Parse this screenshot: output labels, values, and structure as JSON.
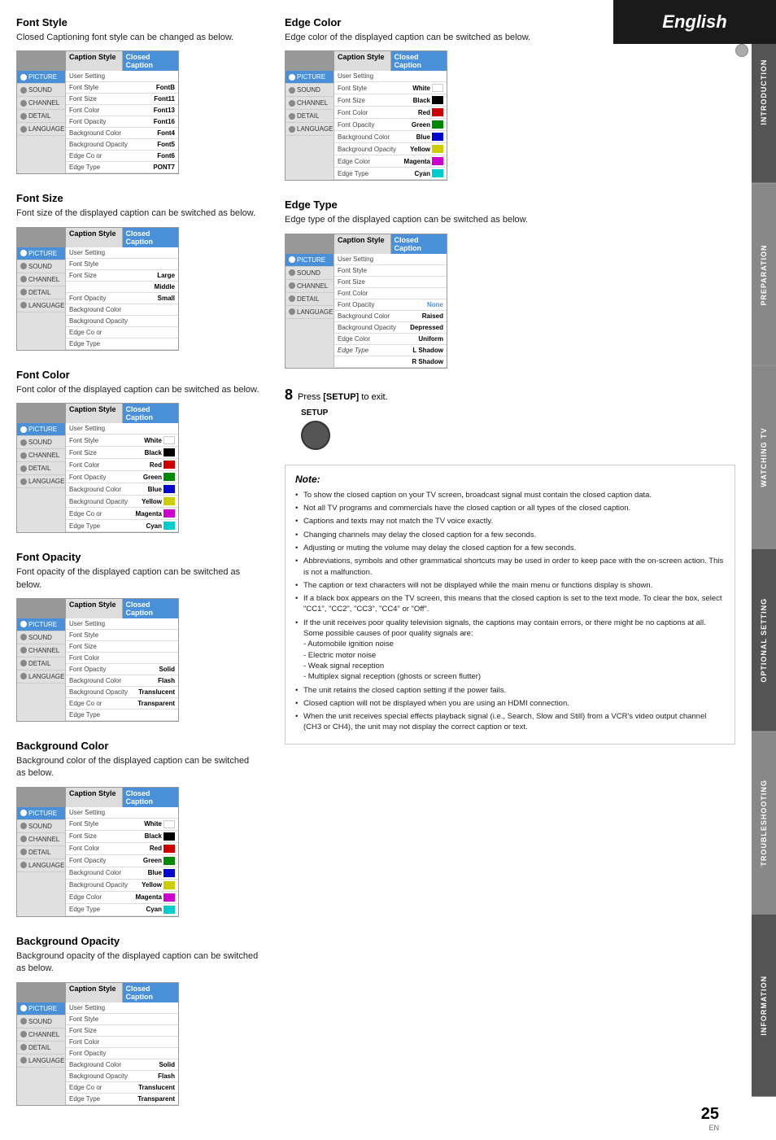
{
  "header": {
    "title": "English"
  },
  "sidebar_tabs": [
    {
      "label": "INTRODUCTION",
      "style": "dark"
    },
    {
      "label": "PREPARATION",
      "style": "accent"
    },
    {
      "label": "WATCHING TV",
      "style": "accent"
    },
    {
      "label": "OPTIONAL SETTING",
      "style": "active"
    },
    {
      "label": "TROUBLESHOOTING",
      "style": "accent"
    },
    {
      "label": "INFORMATION",
      "style": "dark"
    }
  ],
  "sections": {
    "font_style": {
      "title": "Font Style",
      "desc": "Closed Captioning font style can be changed as below.",
      "menu": {
        "col2": "Caption Style",
        "col3": "Closed Caption",
        "sidebar_items": [
          "PICTURE",
          "SOUND",
          "CHANNEL",
          "DETAIL",
          "LANGUAGE"
        ],
        "rows": [
          {
            "label": "User Setting",
            "value": ""
          },
          {
            "label": "Font Style",
            "value": "Font8"
          },
          {
            "label": "Font Size",
            "value": "Font11"
          },
          {
            "label": "Font Color",
            "value": "Font13"
          },
          {
            "label": "Font Opacity",
            "value": "Font16"
          },
          {
            "label": "Background Color",
            "value": "Font4"
          },
          {
            "label": "Background Opacity",
            "value": "Font5"
          },
          {
            "label": "Edge Co or",
            "value": "Font6"
          },
          {
            "label": "Edge Type",
            "value": "PONT7"
          }
        ]
      }
    },
    "font_size": {
      "title": "Font Size",
      "desc": "Font size of the displayed caption can be switched as below.",
      "menu": {
        "col2": "Caption Style",
        "col3": "Closed Caption",
        "sidebar_items": [
          "PICTURE",
          "SOUND",
          "CHANNEL",
          "DETAIL",
          "LANGUAGE"
        ],
        "rows": [
          {
            "label": "User Setting",
            "value": ""
          },
          {
            "label": "Font Style",
            "value": ""
          },
          {
            "label": "Font Size",
            "value": "Large"
          },
          {
            "label": "",
            "value": "Middle"
          },
          {
            "label": "Font Opacity",
            "value": "Small"
          },
          {
            "label": "Background Color",
            "value": ""
          },
          {
            "label": "Background Opacity",
            "value": ""
          },
          {
            "label": "Edge Co or",
            "value": ""
          },
          {
            "label": "Edge Type",
            "value": ""
          }
        ]
      }
    },
    "font_color": {
      "title": "Font Color",
      "desc": "Font color of the displayed caption can be switched as below.",
      "menu": {
        "col2": "Caption Style",
        "col3": "Closed Caption",
        "sidebar_items": [
          "PICTURE",
          "SOUND",
          "CHANNEL",
          "DETAIL",
          "LANGUAGE"
        ],
        "rows": [
          {
            "label": "User Setting",
            "value": ""
          },
          {
            "label": "Font Style",
            "value": "White",
            "swatch": "#fff"
          },
          {
            "label": "Font Size",
            "value": "Black",
            "swatch": "#000"
          },
          {
            "label": "Font Color",
            "value": "Red",
            "swatch": "#c00"
          },
          {
            "label": "Font Opacity",
            "value": "Green",
            "swatch": "#080"
          },
          {
            "label": "Background Color",
            "value": "Blue",
            "swatch": "#00c"
          },
          {
            "label": "Background Opacity",
            "value": "Yellow",
            "swatch": "#cc0"
          },
          {
            "label": "Edge Co or",
            "value": "Magenta",
            "swatch": "#c0c"
          },
          {
            "label": "Edge Type",
            "value": "Cyan",
            "swatch": "#0cc"
          }
        ]
      }
    },
    "font_opacity": {
      "title": "Font Opacity",
      "desc": "Font opacity of the displayed caption can be switched as below.",
      "menu": {
        "col2": "Caption Style",
        "col3": "Closed Caption",
        "sidebar_items": [
          "PICTURE",
          "SOUND",
          "CHANNEL",
          "DETAIL",
          "LANGUAGE"
        ],
        "rows": [
          {
            "label": "User Setting",
            "value": ""
          },
          {
            "label": "Font Style",
            "value": ""
          },
          {
            "label": "Font Size",
            "value": ""
          },
          {
            "label": "Font Color",
            "value": ""
          },
          {
            "label": "Font Opacity",
            "value": "Solid"
          },
          {
            "label": "Background Color",
            "value": "Flash"
          },
          {
            "label": "Background Opacity",
            "value": "Translucent"
          },
          {
            "label": "Edge Co or",
            "value": "Transparent"
          },
          {
            "label": "Edge Type",
            "value": ""
          }
        ]
      }
    },
    "background_color": {
      "title": "Background Color",
      "desc": "Background color of the displayed caption can be switched as below.",
      "menu": {
        "col2": "Caption Style",
        "col3": "Closed Caption",
        "sidebar_items": [
          "PICTURE",
          "SOUND",
          "CHANNEL",
          "DETAIL",
          "LANGUAGE"
        ],
        "rows": [
          {
            "label": "User Setting",
            "value": ""
          },
          {
            "label": "Font Style",
            "value": "White",
            "swatch": "#fff"
          },
          {
            "label": "Font Size",
            "value": "Black",
            "swatch": "#000"
          },
          {
            "label": "Font Color",
            "value": "Red",
            "swatch": "#c00"
          },
          {
            "label": "Font Opacity",
            "value": "Green",
            "swatch": "#080"
          },
          {
            "label": "Background Color",
            "value": "Blue",
            "swatch": "#00c"
          },
          {
            "label": "Background Opacity",
            "value": "Yellow",
            "swatch": "#cc0"
          },
          {
            "label": "Edge Color",
            "value": "Magenta",
            "swatch": "#c0c"
          },
          {
            "label": "Edge Type",
            "value": "Cyan",
            "swatch": "#0cc"
          }
        ]
      }
    },
    "background_opacity": {
      "title": "Background Opacity",
      "desc": "Background opacity of the displayed caption can be switched as below.",
      "menu": {
        "col2": "Caption Style",
        "col3": "Closed Caption",
        "sidebar_items": [
          "PICTURE",
          "SOUND",
          "CHANNEL",
          "DETAIL",
          "LANGUAGE"
        ],
        "rows": [
          {
            "label": "User Setting",
            "value": ""
          },
          {
            "label": "Font Style",
            "value": ""
          },
          {
            "label": "Font Size",
            "value": ""
          },
          {
            "label": "Font Color",
            "value": ""
          },
          {
            "label": "Font Opacity",
            "value": ""
          },
          {
            "label": "Background Color",
            "value": "Solid"
          },
          {
            "label": "Background Opacity",
            "value": "Flash"
          },
          {
            "label": "Edge Co or",
            "value": "Translucent"
          },
          {
            "label": "Edge Type",
            "value": "Transparent"
          }
        ]
      }
    },
    "edge_color": {
      "title": "Edge Color",
      "desc": "Edge color of the displayed caption can be switched as below.",
      "menu": {
        "col2": "Caption Style",
        "col3": "Closed Caption",
        "sidebar_items": [
          "PICTURE",
          "SOUND",
          "CHANNEL",
          "DETAIL",
          "LANGUAGE"
        ],
        "rows": [
          {
            "label": "User Setting",
            "value": ""
          },
          {
            "label": "Font Style",
            "value": "White",
            "swatch": "#fff"
          },
          {
            "label": "Font Size",
            "value": "Black",
            "swatch": "#000"
          },
          {
            "label": "Font Color",
            "value": "Red",
            "swatch": "#c00"
          },
          {
            "label": "Font Opacity",
            "value": "Green",
            "swatch": "#080"
          },
          {
            "label": "Background Color",
            "value": "Blue",
            "swatch": "#00c"
          },
          {
            "label": "Background Opacity",
            "value": "Yellow",
            "swatch": "#cc0"
          },
          {
            "label": "Edge Color",
            "value": "Magenta",
            "swatch": "#c0c"
          },
          {
            "label": "Edge Type",
            "value": "Cyan",
            "swatch": "#0cc"
          }
        ]
      }
    },
    "edge_type": {
      "title": "Edge Type",
      "desc": "Edge type of the displayed caption can be switched as below.",
      "menu": {
        "col2": "Caption Style",
        "col3": "Closed Caption",
        "sidebar_items": [
          "PICTURE",
          "SOUND",
          "CHANNEL",
          "DETAIL",
          "LANGUAGE"
        ],
        "rows": [
          {
            "label": "User Setting",
            "value": ""
          },
          {
            "label": "Font Style",
            "value": ""
          },
          {
            "label": "Font Size",
            "value": ""
          },
          {
            "label": "Font Color",
            "value": ""
          },
          {
            "label": "Font Opacity",
            "value": "None"
          },
          {
            "label": "Background Color",
            "value": "Raised"
          },
          {
            "label": "Background Opacity",
            "value": "Depressed"
          },
          {
            "label": "Edge Color",
            "value": "Uniform"
          },
          {
            "label": "Edge Type",
            "value": "L Shadow",
            "extra": "R Shadow"
          }
        ]
      }
    }
  },
  "step8": {
    "number": "8",
    "text_before": "Press ",
    "bold_text": "[SETUP]",
    "text_after": " to exit.",
    "button_label": "SETUP"
  },
  "note": {
    "title": "Note:",
    "items": [
      "To show the closed caption on your TV screen, broadcast signal must contain the closed caption data.",
      "Not all TV programs and commercials have the closed caption or all types of the closed caption.",
      "Captions and texts may not match the TV voice exactly.",
      "Changing channels may delay the closed caption for a few seconds.",
      "Adjusting or muting the volume may delay the closed caption for a few seconds.",
      "Abbreviations, symbols and other grammatical shortcuts may be used in order to keep pace with the on-screen action. This is not a malfunction.",
      "The caption or text characters will not be displayed while the main menu or functions display is shown.",
      "If a black box appears on the TV screen, this means that the closed caption is set to the text mode. To clear the box, select \"CC1\", \"CC2\", \"CC3\", \"CC4\" or \"Off\".",
      "If the unit receives poor quality television signals, the captions may contain errors, or there might be no captions at all. Some possible causes of poor quality signals are:\n- Automobile ignition noise\n- Electric motor noise\n- Weak signal reception\n- Multiplex signal reception (ghosts or screen flutter)",
      "The unit retains the closed caption setting if the power fails.",
      "Closed caption will not be displayed when you are using an HDMI connection.",
      "When the unit receives special effects playback signal (i.e., Search, Slow and Still) from a VCR's video output channel (CH3 or CH4), the unit may not display the correct caption or text."
    ]
  },
  "page": {
    "number": "25",
    "en": "EN"
  }
}
